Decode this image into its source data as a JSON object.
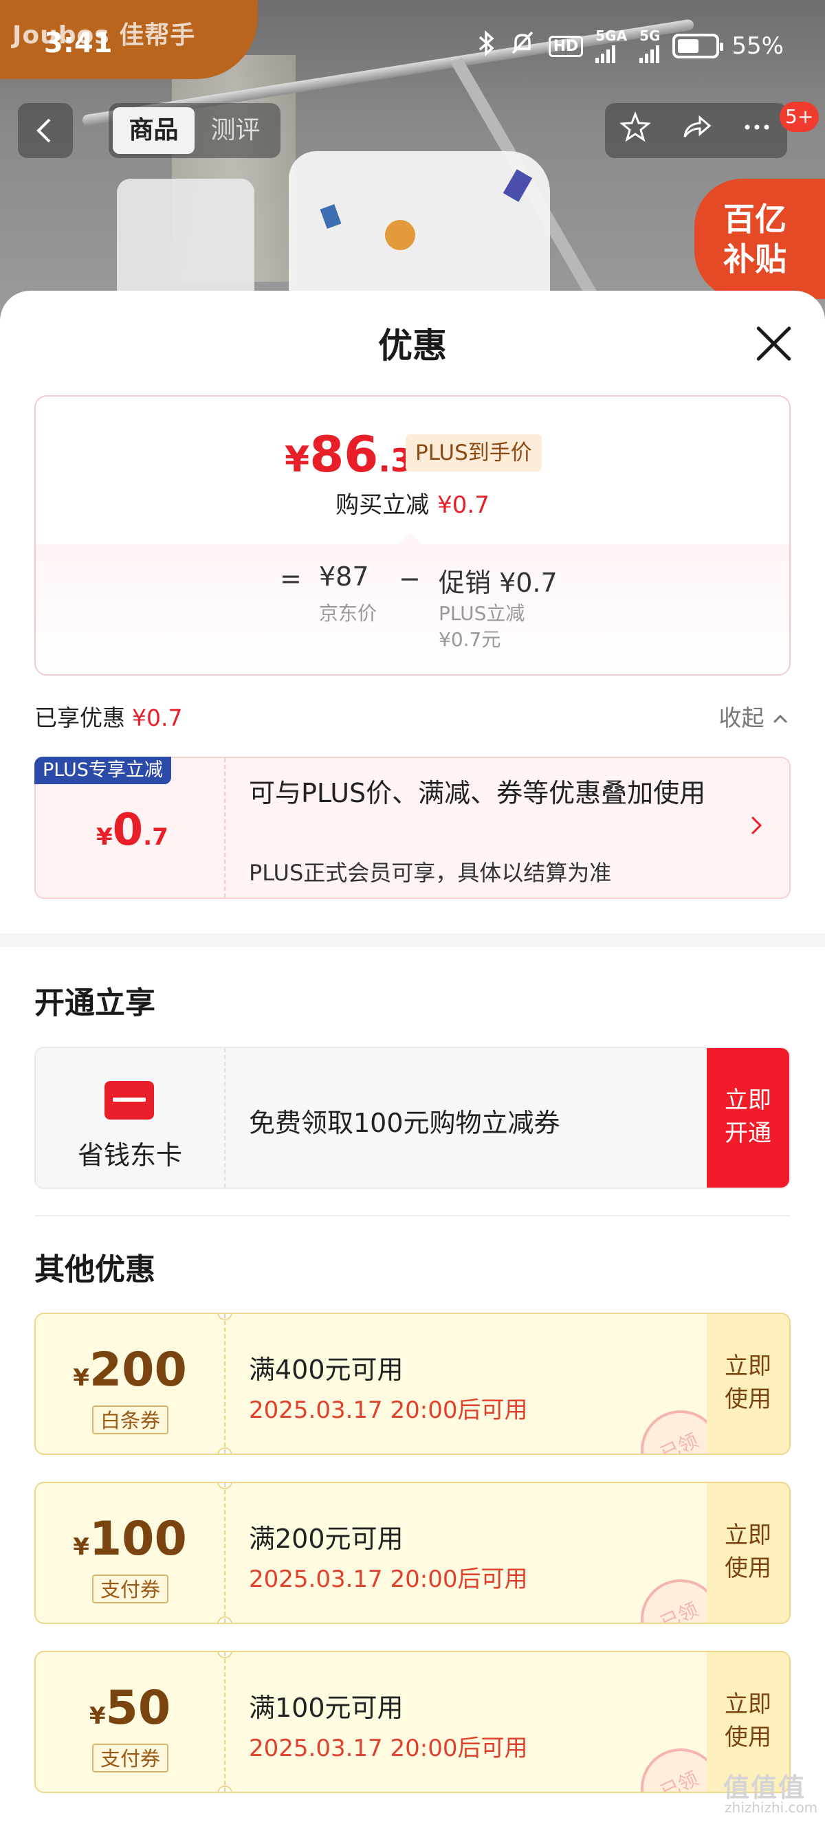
{
  "status_bar": {
    "time": "3:41",
    "hd": "HD",
    "net1": "5GA",
    "net2": "5G",
    "battery": "55%"
  },
  "brand": {
    "name": "Joubos 佳帮手"
  },
  "nav": {
    "back_icon": "chevron-left-icon",
    "tabs": [
      "商品",
      "测评"
    ],
    "active_tab": "商品",
    "actions": [
      "star-icon",
      "share-icon",
      "more-icon"
    ],
    "badge": "5+"
  },
  "subsidy_badge": {
    "line1": "百亿",
    "line2": "补贴"
  },
  "sheet": {
    "title": "优惠",
    "summary": {
      "price_symbol": "¥",
      "price_int": "86",
      "price_dec": ".3",
      "price_tag": "PLUS到手价",
      "instant_label": "购买立减",
      "instant_value": "¥0.7",
      "eq": "=",
      "base_price": "¥87",
      "base_label": "京东价",
      "minus": "−",
      "promo_value": "促销 ¥0.7",
      "promo_sub1": "PLUS立减",
      "promo_sub2": "¥0.7元"
    },
    "enjoyed": {
      "label": "已享优惠",
      "value": "¥0.7",
      "collapse": "收起"
    },
    "plus_card": {
      "tag": "PLUS专享立减",
      "symbol": "¥",
      "int": "0",
      "dec": ".7",
      "text": "可与PLUS价、满减、券等优惠叠加使用",
      "sub": "PLUS正式会员可享，具体以结算为准"
    },
    "open_section": {
      "title": "开通立享",
      "card_name": "省钱东卡",
      "desc": "免费领取100元购物立减券",
      "button_l1": "立即",
      "button_l2": "开通"
    },
    "other_section": {
      "title": "其他优惠",
      "coupons": [
        {
          "symbol": "¥",
          "amount": "200",
          "type": "白条券",
          "condition": "满400元可用",
          "time": "2025.03.17 20:00后可用",
          "btn_l1": "立即",
          "btn_l2": "使用",
          "stamp": "已领"
        },
        {
          "symbol": "¥",
          "amount": "100",
          "type": "支付券",
          "condition": "满200元可用",
          "time": "2025.03.17 20:00后可用",
          "btn_l1": "立即",
          "btn_l2": "使用",
          "stamp": "已领"
        },
        {
          "symbol": "¥",
          "amount": "50",
          "type": "支付券",
          "condition": "满100元可用",
          "time": "2025.03.17 20:00后可用",
          "btn_l1": "立即",
          "btn_l2": "使用",
          "stamp": "已领"
        }
      ]
    }
  },
  "watermark": {
    "logo": "值值值",
    "site": "zhizhizhi.com"
  }
}
